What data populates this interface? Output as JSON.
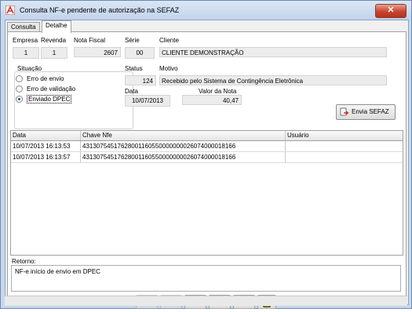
{
  "window": {
    "title": "Consulta NF-e pendente de autorização na SEFAZ",
    "close_glyph": "✕"
  },
  "tabs": [
    {
      "label": "Consulta",
      "active": false
    },
    {
      "label": "Detalhe",
      "active": true
    }
  ],
  "fields": {
    "empresa_label": "Empresa",
    "empresa_value": "1",
    "revenda_label": "Revenda",
    "revenda_value": "1",
    "nota_fiscal_label": "Nota Fiscal",
    "nota_fiscal_value": "2607",
    "serie_label": "Série",
    "serie_value": "00",
    "cliente_label": "Cliente",
    "cliente_value": "CLIENTE DEMONSTRAÇÃO",
    "status_label": "Status",
    "status_value": "124",
    "motivo_label": "Motivo",
    "motivo_value": "Recebido pelo Sistema de Contingência Eletrônica",
    "data_label": "Data",
    "data_value": "10/07/2013",
    "valor_label": "Valor da Nota",
    "valor_value": "40,47"
  },
  "situacao": {
    "label": "Situação",
    "options": [
      {
        "label": "Erro de envio",
        "selected": false
      },
      {
        "label": "Erro de validação",
        "selected": false
      },
      {
        "label": "Enviado DPEC",
        "selected": true
      }
    ]
  },
  "send_button": {
    "label": "Envia SEFAZ",
    "icon": "send-document-icon"
  },
  "grid": {
    "columns": [
      "Data",
      "Chave Nfe",
      "Usuário"
    ],
    "rows": [
      [
        "10/07/2013 16:13:53",
        "43130754517628001160550000000026074000018166",
        ""
      ],
      [
        "10/07/2013 16:13:57",
        "43130754517628001160550000000026074000018166",
        ""
      ]
    ]
  },
  "retorno": {
    "label": "Retorno:",
    "value": "NF-e início de envio em DPEC"
  },
  "navigation": {
    "buttons": [
      {
        "name": "first-record",
        "icon": "first-icon",
        "enabled": false
      },
      {
        "name": "previous-record",
        "icon": "previous-icon",
        "enabled": false
      },
      {
        "name": "next-record",
        "icon": "next-icon",
        "enabled": true
      },
      {
        "name": "last-record",
        "icon": "last-icon",
        "enabled": true
      },
      {
        "name": "refresh",
        "icon": "refresh-icon",
        "enabled": true
      },
      {
        "name": "exit",
        "icon": "exit-door-icon",
        "enabled": true
      }
    ]
  },
  "colors": {
    "title_bar": "#c7d8ee",
    "close_button": "#c7432c",
    "field_bg": "#ececec",
    "radio_dot": "#1f4e9e"
  }
}
